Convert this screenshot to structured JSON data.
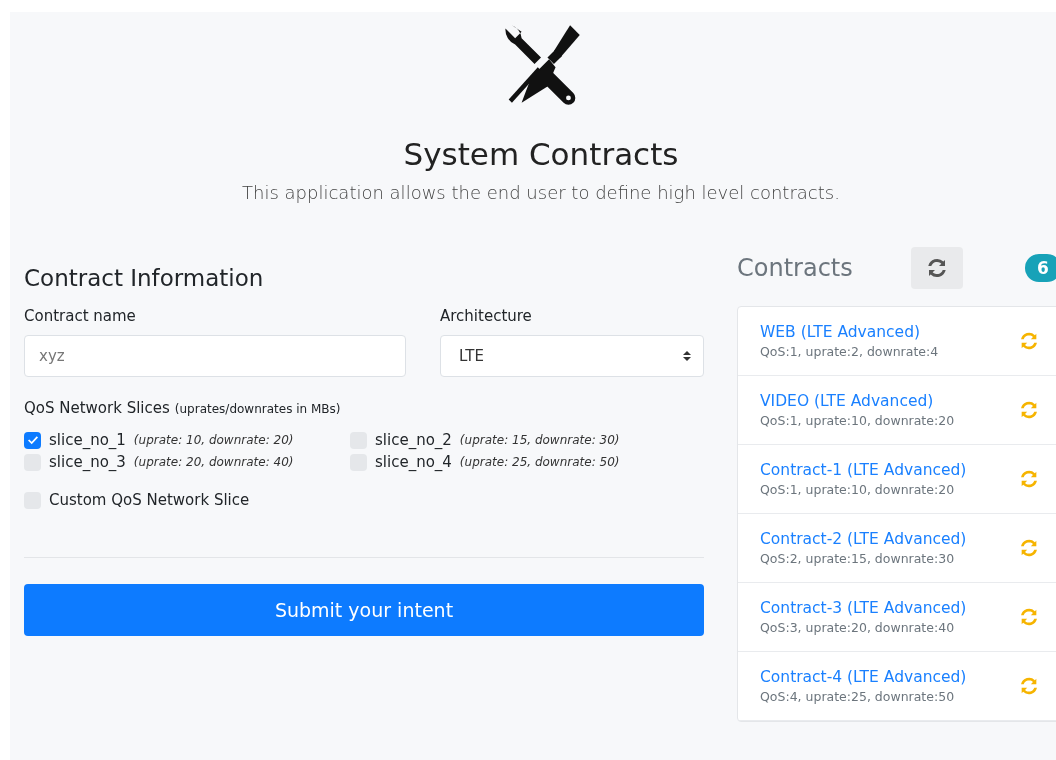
{
  "header": {
    "title": "System Contracts",
    "subtitle": "This application allows the end user to define high level contracts."
  },
  "form": {
    "heading": "Contract Information",
    "name_field": {
      "label": "Contract name",
      "placeholder": "xyz"
    },
    "architecture": {
      "label": "Architecture",
      "value": "LTE"
    },
    "slices_label": {
      "text": "QoS Network Slices",
      "note": "(uprates/downrates in MBs)"
    },
    "slices": [
      {
        "name": "slice_no_1",
        "detail": "(uprate: 10, downrate: 20)",
        "checked": true
      },
      {
        "name": "slice_no_2",
        "detail": "(uprate: 15, downrate: 30)",
        "checked": false
      },
      {
        "name": "slice_no_3",
        "detail": "(uprate: 20, downrate: 40)",
        "checked": false
      },
      {
        "name": "slice_no_4",
        "detail": "(uprate: 25, downrate: 50)",
        "checked": false
      }
    ],
    "custom_slice": {
      "label": "Custom QoS Network Slice",
      "checked": false
    },
    "submit": "Submit your intent"
  },
  "contracts": {
    "heading": "Contracts",
    "count": "6",
    "items": [
      {
        "title": "WEB (LTE Advanced)",
        "detail": "QoS:1, uprate:2, downrate:4"
      },
      {
        "title": "VIDEO (LTE Advanced)",
        "detail": "QoS:1, uprate:10, downrate:20"
      },
      {
        "title": "Contract-1 (LTE Advanced)",
        "detail": "QoS:1, uprate:10, downrate:20"
      },
      {
        "title": "Contract-2 (LTE Advanced)",
        "detail": "QoS:2, uprate:15, downrate:30"
      },
      {
        "title": "Contract-3 (LTE Advanced)",
        "detail": "QoS:3, uprate:20, downrate:40"
      },
      {
        "title": "Contract-4 (LTE Advanced)",
        "detail": "QoS:4, uprate:25, downrate:50"
      }
    ]
  }
}
